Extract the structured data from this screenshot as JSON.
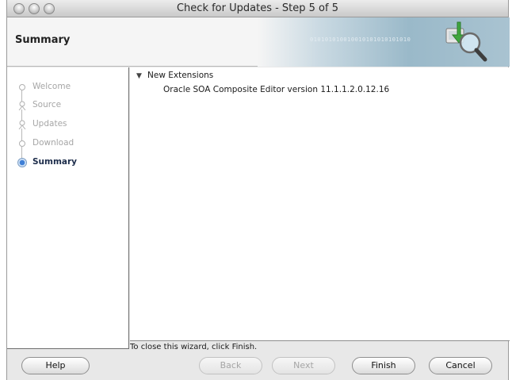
{
  "window": {
    "title": "Check for Updates - Step 5 of 5"
  },
  "header": {
    "title": "Summary",
    "binary_text": "010101010010010101010101010"
  },
  "steps": [
    {
      "label": "Welcome",
      "state": "done"
    },
    {
      "label": "Source",
      "state": "done"
    },
    {
      "label": "Updates",
      "state": "done"
    },
    {
      "label": "Download",
      "state": "done"
    },
    {
      "label": "Summary",
      "state": "active"
    }
  ],
  "tree": {
    "root_label": "New Extensions",
    "expanded": true,
    "children": [
      {
        "label": "Oracle SOA Composite Editor version 11.1.1.2.0.12.16"
      }
    ]
  },
  "footer": {
    "hint": "To close this wizard, click Finish."
  },
  "buttons": {
    "help": "Help",
    "back": "Back",
    "next": "Next",
    "finish": "Finish",
    "cancel": "Cancel"
  },
  "colors": {
    "active_step": "#1c2c4a",
    "inactive_step": "#a6a6a6",
    "active_dot": "#3f7fd6"
  }
}
